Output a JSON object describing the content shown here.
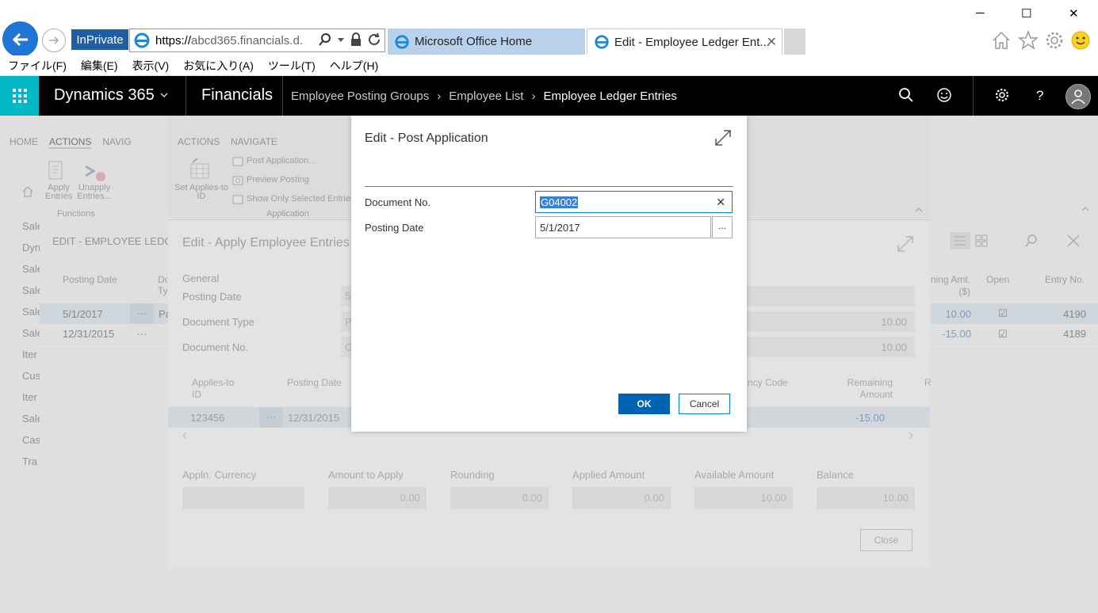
{
  "browser": {
    "inprivate_label": "InPrivate",
    "url_prefix": "https://",
    "url_host": "abcd365.financials.d.",
    "tabs": [
      {
        "title": "Microsoft Office Home"
      },
      {
        "title": "Edit - Employee Ledger Ent..."
      }
    ],
    "menu": [
      "ファイル(F)",
      "編集(E)",
      "表示(V)",
      "お気に入り(A)",
      "ツール(T)",
      "ヘルプ(H)"
    ],
    "win_min": "─",
    "win_max": "☐",
    "win_close": "✕",
    "tab_close": "✕"
  },
  "d365": {
    "app_name": "Dynamics 365",
    "module": "Financials",
    "breadcrumbs": [
      "Employee Posting Groups",
      "Employee List",
      "Employee Ledger Entries"
    ],
    "crumb_sep": "›"
  },
  "background": {
    "ribbon_tabs": [
      "HOME",
      "ACTIONS",
      "NAVIG"
    ],
    "apply_ribbon_tabs": [
      "ACTIONS",
      "NAVIGATE"
    ],
    "functions_group": "Functions",
    "apply_entries": "Apply Entries",
    "unapply_entries": "Unapply Entries...",
    "application_group": "Application",
    "set_applies_to": "Set Applies-to ID",
    "post_application": "Post Application...",
    "preview_posting": "Preview Posting",
    "show_only_selected": "Show Only Selected Entries",
    "page_header": "EDIT - EMPLOYEE LEDGER",
    "sidebar_items": [
      "Sale",
      "Dyn",
      "Sale",
      "Sale",
      "Sale",
      "Sale",
      "Iter",
      "Cus",
      "Iter",
      "Sale",
      "Cas",
      "Tra"
    ],
    "col_posting_date": "Posting Date",
    "col_doc_type": "Do Ty",
    "col_remaining": "ning Amt. ($)",
    "col_open": "Open",
    "col_entry_no": "Entry No.",
    "rows": [
      {
        "date": "5/1/2017",
        "type": "Pa",
        "remaining": "10.00",
        "entry": "4190"
      },
      {
        "date": "12/31/2015",
        "type": "",
        "remaining": "-15.00",
        "entry": "4189"
      }
    ],
    "row_menu": "···",
    "open_check": "☑"
  },
  "apply_panel": {
    "title": "Edit - Apply Employee Entries -",
    "general": "General",
    "posting_date_label": "Posting Date",
    "posting_date_value": "5",
    "doc_type_label": "Document Type",
    "doc_type_value": "P",
    "doc_no_label": "Document No.",
    "doc_no_value": "G",
    "amount1": "10.00",
    "amount2": "10.00",
    "col_applies_to": "Applies-to ID",
    "col_posting_date": "Posting Date",
    "col_currency": "ncy Code",
    "col_remaining": "Remaining Amount",
    "col_r": "R",
    "row_id": "123456",
    "row_date": "12/31/2015",
    "row_amount": "-15.00",
    "row_menu": "···",
    "nav_left": "‹",
    "nav_right": "›",
    "bottom_labels": [
      "Appln. Currency",
      "Amount to Apply",
      "Rounding",
      "Applied Amount",
      "Available Amount",
      "Balance"
    ],
    "bottom_values": [
      "",
      "0.00",
      "0.00",
      "0.00",
      "10.00",
      "10.00"
    ],
    "close_label": "Close"
  },
  "dialog": {
    "title": "Edit - Post Application",
    "doc_no_label": "Document No.",
    "doc_no_value": "G04002",
    "posting_date_label": "Posting Date",
    "posting_date_value": "5/1/2017",
    "dots": "...",
    "clear": "✕",
    "ok_label": "OK",
    "cancel_label": "Cancel"
  },
  "colors": {
    "accent": "#0063b1",
    "waffle": "#00b7c3",
    "topbar": "#000000"
  }
}
